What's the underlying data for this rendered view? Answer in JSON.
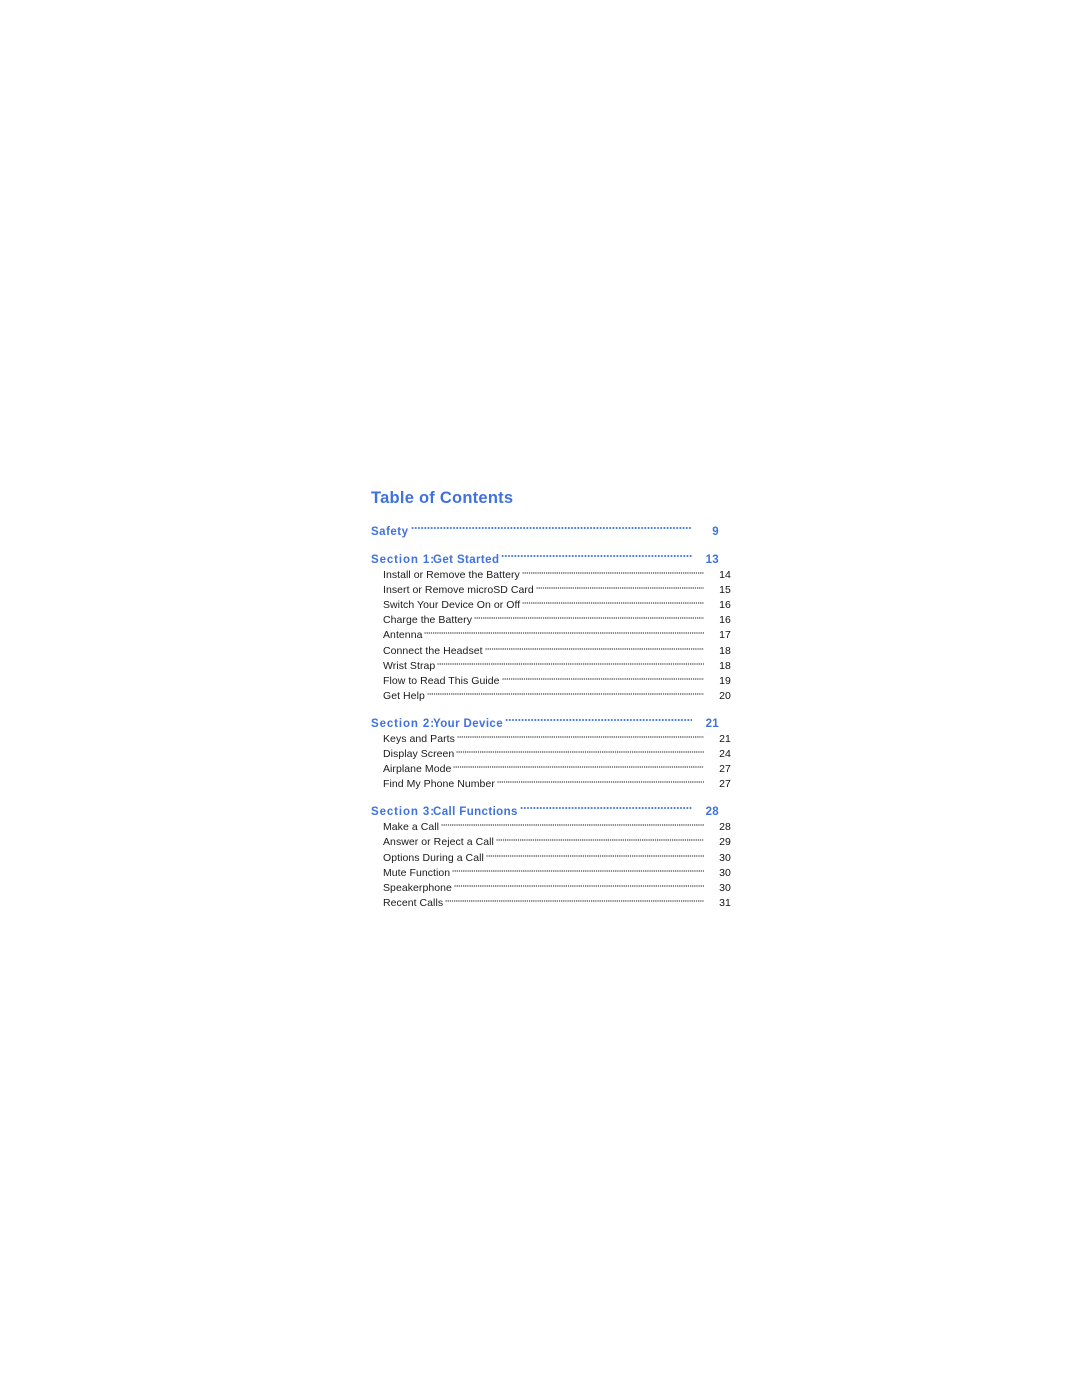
{
  "page": {
    "background_color": "#ffffff",
    "accent_color": "#3f72dc",
    "body_text_color": "#1a1a1a"
  },
  "toc": {
    "title": "Table of Contents",
    "entries": [
      {
        "level": 1,
        "prefix": "",
        "label": "Safety",
        "page": "9"
      },
      {
        "level": 1,
        "prefix": "Section 1:",
        "label": "Get Started",
        "page": "13"
      },
      {
        "level": 2,
        "label": "Install or Remove the Battery",
        "page": "14"
      },
      {
        "level": 2,
        "label": "Insert or Remove microSD Card",
        "page": "15"
      },
      {
        "level": 2,
        "label": "Switch Your Device On or Off",
        "page": "16"
      },
      {
        "level": 2,
        "label": "Charge the Battery",
        "page": "16"
      },
      {
        "level": 2,
        "label": "Antenna",
        "page": "17"
      },
      {
        "level": 2,
        "label": "Connect the Headset",
        "page": "18"
      },
      {
        "level": 2,
        "label": "Wrist Strap",
        "page": "18"
      },
      {
        "level": 2,
        "label": "Flow to Read This Guide",
        "page": "19"
      },
      {
        "level": 2,
        "label": "Get Help",
        "page": "20"
      },
      {
        "level": 1,
        "prefix": "Section 2:",
        "label": "Your Device",
        "page": "21"
      },
      {
        "level": 2,
        "label": "Keys and Parts",
        "page": "21"
      },
      {
        "level": 2,
        "label": "Display Screen",
        "page": "24"
      },
      {
        "level": 2,
        "label": "Airplane Mode",
        "page": "27"
      },
      {
        "level": 2,
        "label": "Find My Phone Number",
        "page": "27"
      },
      {
        "level": 1,
        "prefix": "Section 3:",
        "label": "Call Functions",
        "page": "28"
      },
      {
        "level": 2,
        "label": "Make a Call",
        "page": "28"
      },
      {
        "level": 2,
        "label": "Answer or Reject a Call",
        "page": "29"
      },
      {
        "level": 2,
        "label": "Options During a Call",
        "page": "30"
      },
      {
        "level": 2,
        "label": "Mute Function",
        "page": "30"
      },
      {
        "level": 2,
        "label": "Speakerphone",
        "page": "30"
      },
      {
        "level": 2,
        "label": "Recent Calls",
        "page": "31"
      }
    ]
  }
}
